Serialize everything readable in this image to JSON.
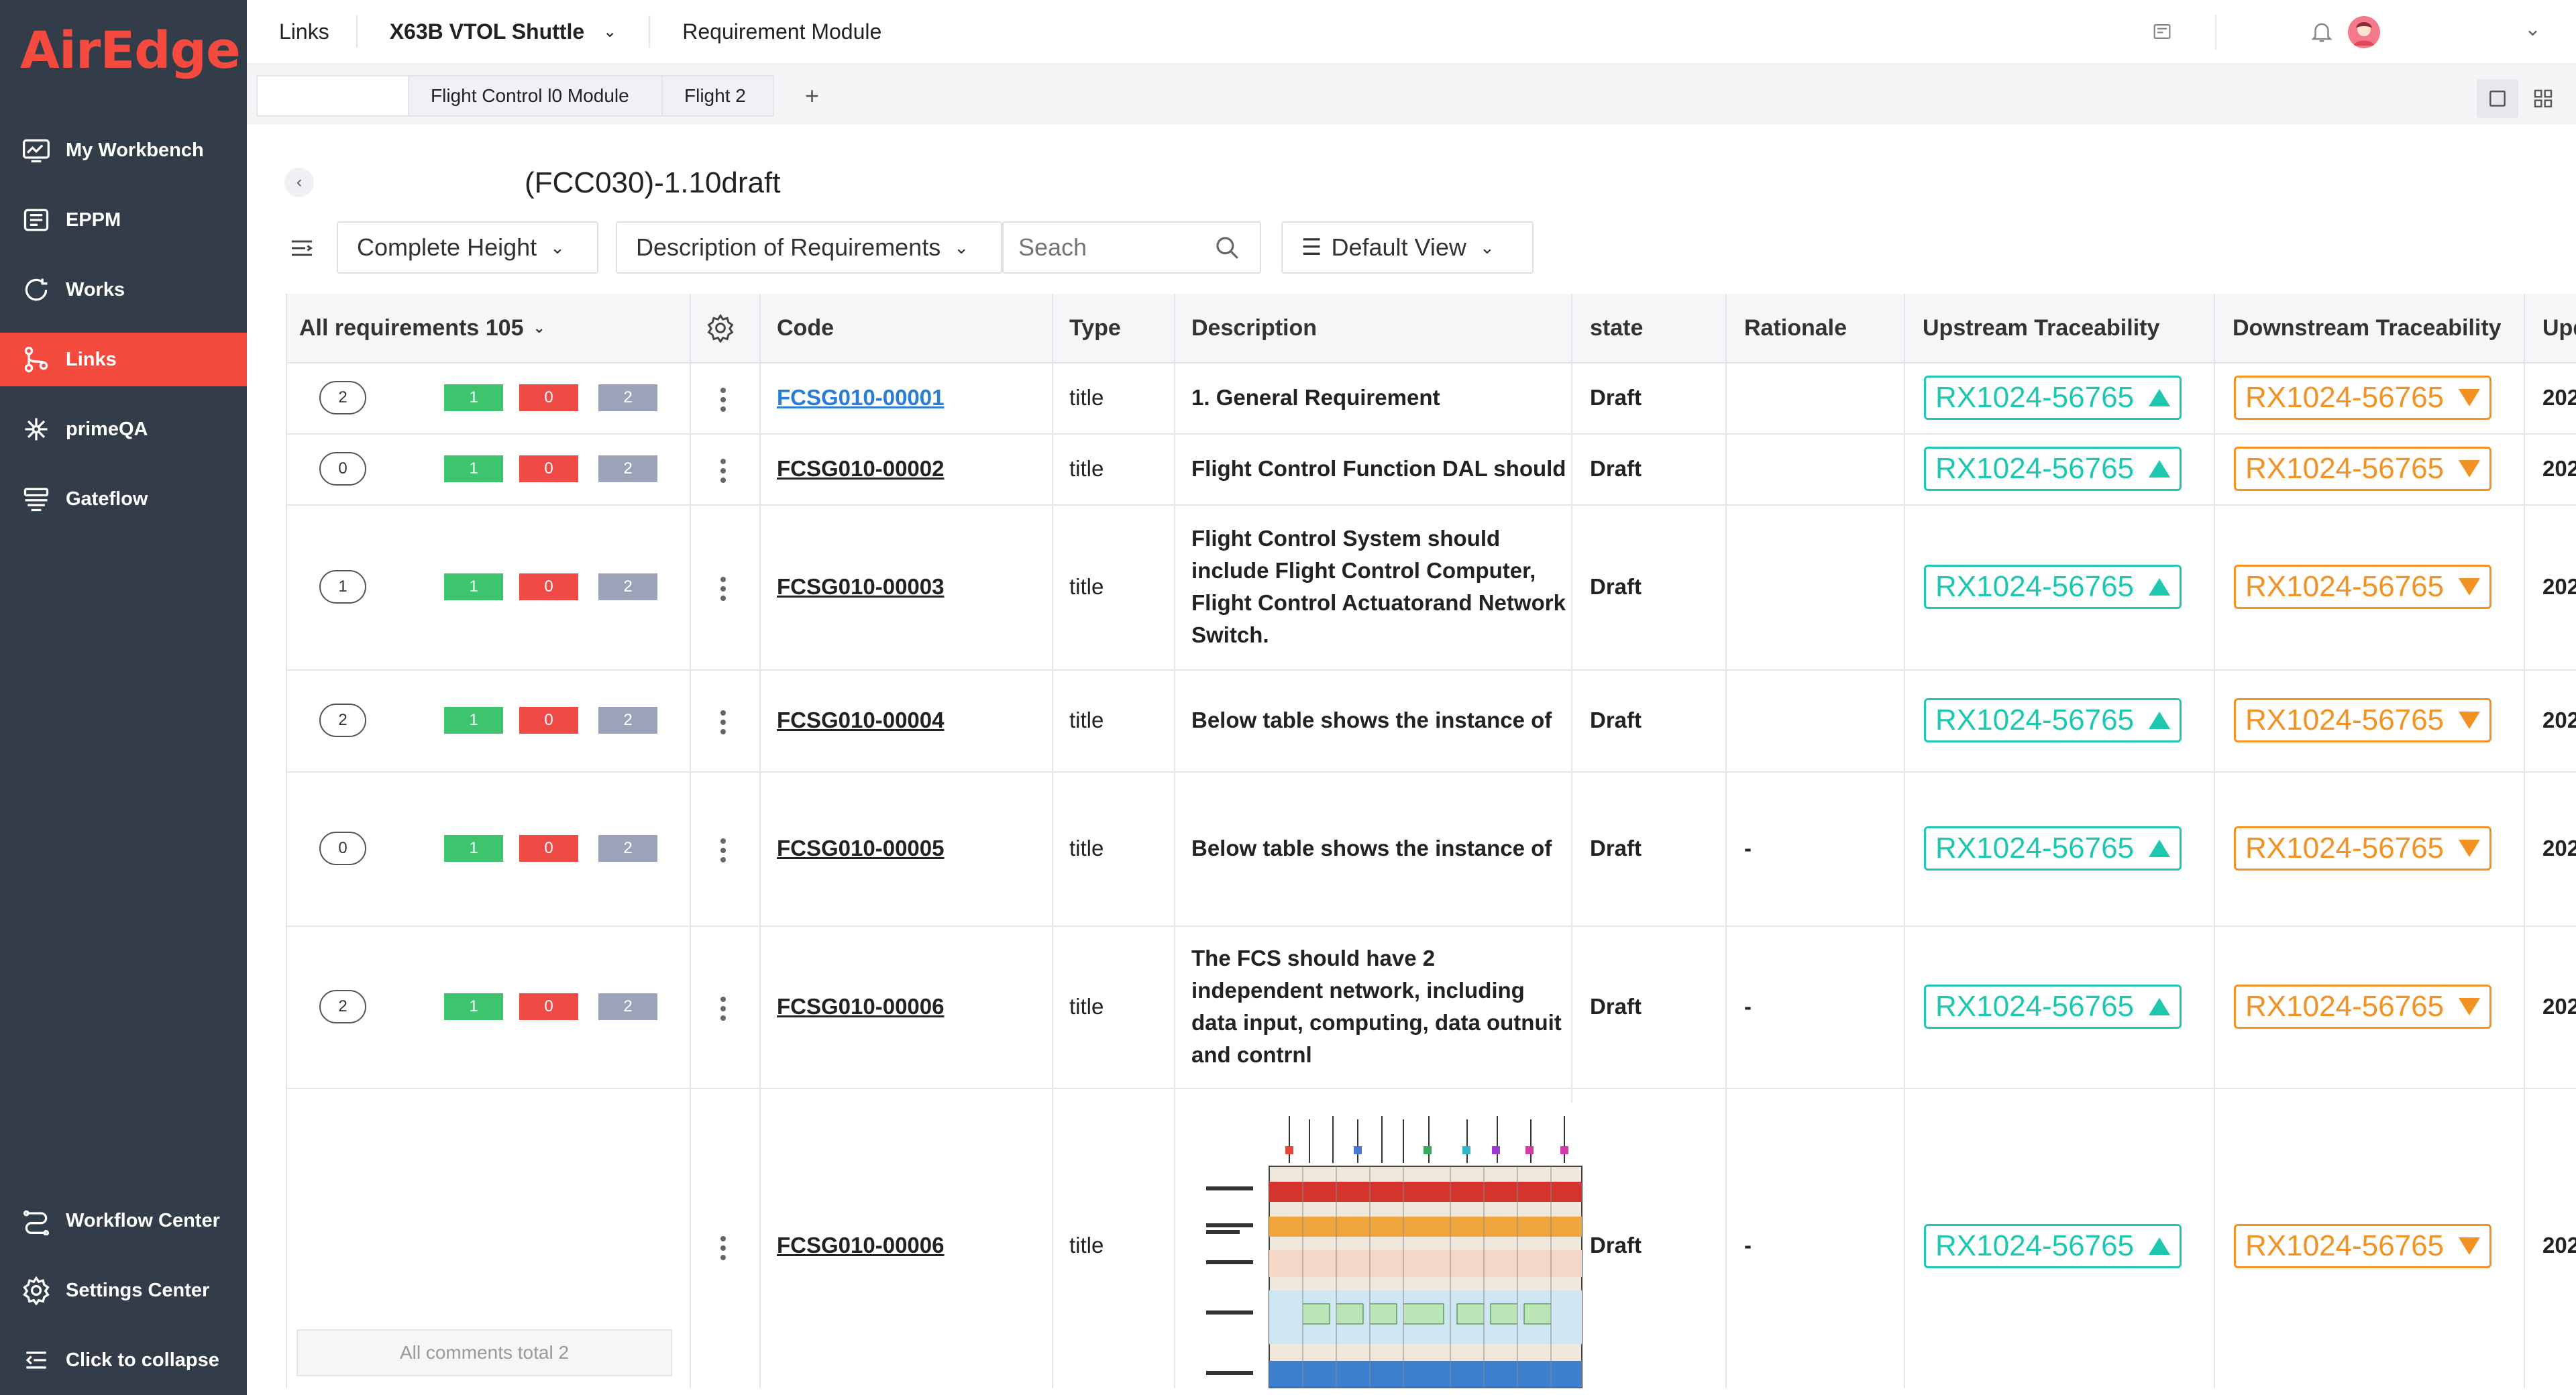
{
  "app": {
    "logo": "AirEdge"
  },
  "sidebar": {
    "items": [
      {
        "label": "My Workbench",
        "icon": "chart-monitor-icon"
      },
      {
        "label": "EPPM",
        "icon": "book-icon"
      },
      {
        "label": "Works",
        "icon": "refresh-cycle-icon"
      },
      {
        "label": "Links",
        "icon": "branch-link-icon",
        "active": true
      },
      {
        "label": "primeQA",
        "icon": "network-node-icon"
      },
      {
        "label": "Gateflow",
        "icon": "stack-flow-icon"
      }
    ],
    "bottom": [
      {
        "label": "Workflow Center",
        "icon": "workflow-icon"
      },
      {
        "label": "Settings Center",
        "icon": "gear-icon"
      },
      {
        "label": "Click to collapse",
        "icon": "collapse-icon"
      }
    ]
  },
  "topbar": {
    "module": "Links",
    "project": "X63B VTOL Shuttle",
    "section": "Requirement Module"
  },
  "tabs": [
    "",
    "Flight Control l0 Module",
    "Flight 2",
    "+"
  ],
  "document": {
    "title": "(FCC030)-1.10draft"
  },
  "toolbar": {
    "height_select": "Complete Height",
    "field_select": "Description of Requirements",
    "search_placeholder": "Seach",
    "view_select": "Default View"
  },
  "table": {
    "headers": {
      "all": "All requirements 105",
      "code": "Code",
      "type": "Type",
      "description": "Description",
      "state": "state",
      "rationale": "Rationale",
      "upstream": "Upstream Traceability",
      "downstream": "Downstream Traceability",
      "update": "Upd"
    },
    "rows": [
      {
        "comments": "2",
        "green": "1",
        "red": "0",
        "grey": "2",
        "code": "FCSG010-00001",
        "type": "title",
        "description": "1. General Requirement",
        "state": "Draft",
        "rationale": "",
        "upstream": "RX1024-56765",
        "downstream": "RX1024-56765",
        "update": "202"
      },
      {
        "comments": "0",
        "green": "1",
        "red": "0",
        "grey": "2",
        "code": "FCSG010-00002",
        "type": "title",
        "description": "Flight Control Function DAL should",
        "state": "Draft",
        "rationale": "",
        "upstream": "RX1024-56765",
        "downstream": "RX1024-56765",
        "update": "202"
      },
      {
        "comments": "1",
        "green": "1",
        "red": "0",
        "grey": "2",
        "code": "FCSG010-00003",
        "type": "title",
        "description": "Flight Control System should include Flight Control Computer, Flight Control Actuatorand Network Switch.",
        "state": "Draft",
        "rationale": "",
        "upstream": "RX1024-56765",
        "downstream": "RX1024-56765",
        "update": "202"
      },
      {
        "comments": "2",
        "green": "1",
        "red": "0",
        "grey": "2",
        "code": "FCSG010-00004",
        "type": "title",
        "description": "Below table shows the instance of",
        "state": "Draft",
        "rationale": "",
        "upstream": "RX1024-56765",
        "downstream": "RX1024-56765",
        "update": "202"
      },
      {
        "comments": "0",
        "green": "1",
        "red": "0",
        "grey": "2",
        "code": "FCSG010-00005",
        "type": "title",
        "description": "Below table shows the instance of",
        "state": "Draft",
        "rationale": "-",
        "upstream": "RX1024-56765",
        "downstream": "RX1024-56765",
        "update": "202"
      },
      {
        "comments": "2",
        "green": "1",
        "red": "0",
        "grey": "2",
        "code": "FCSG010-00006",
        "type": "title",
        "description": "The FCS should have 2 independent network, including data input, computing, data outnuit and contrnl",
        "state": "Draft",
        "rationale": "-",
        "upstream": "RX1024-56765",
        "downstream": "RX1024-56765",
        "update": "202"
      },
      {
        "comments": "",
        "code": "FCSG010-00006",
        "type": "title",
        "description": "",
        "state": "Draft",
        "rationale": "-",
        "upstream": "RX1024-56765",
        "downstream": "RX1024-56765",
        "update": "202"
      }
    ],
    "comments_total": "All comments total 2"
  },
  "colors": {
    "sidebar": "#333c49",
    "accent": "#f54b3f",
    "upstream": "#1ec7b0",
    "downstream": "#f39224"
  }
}
